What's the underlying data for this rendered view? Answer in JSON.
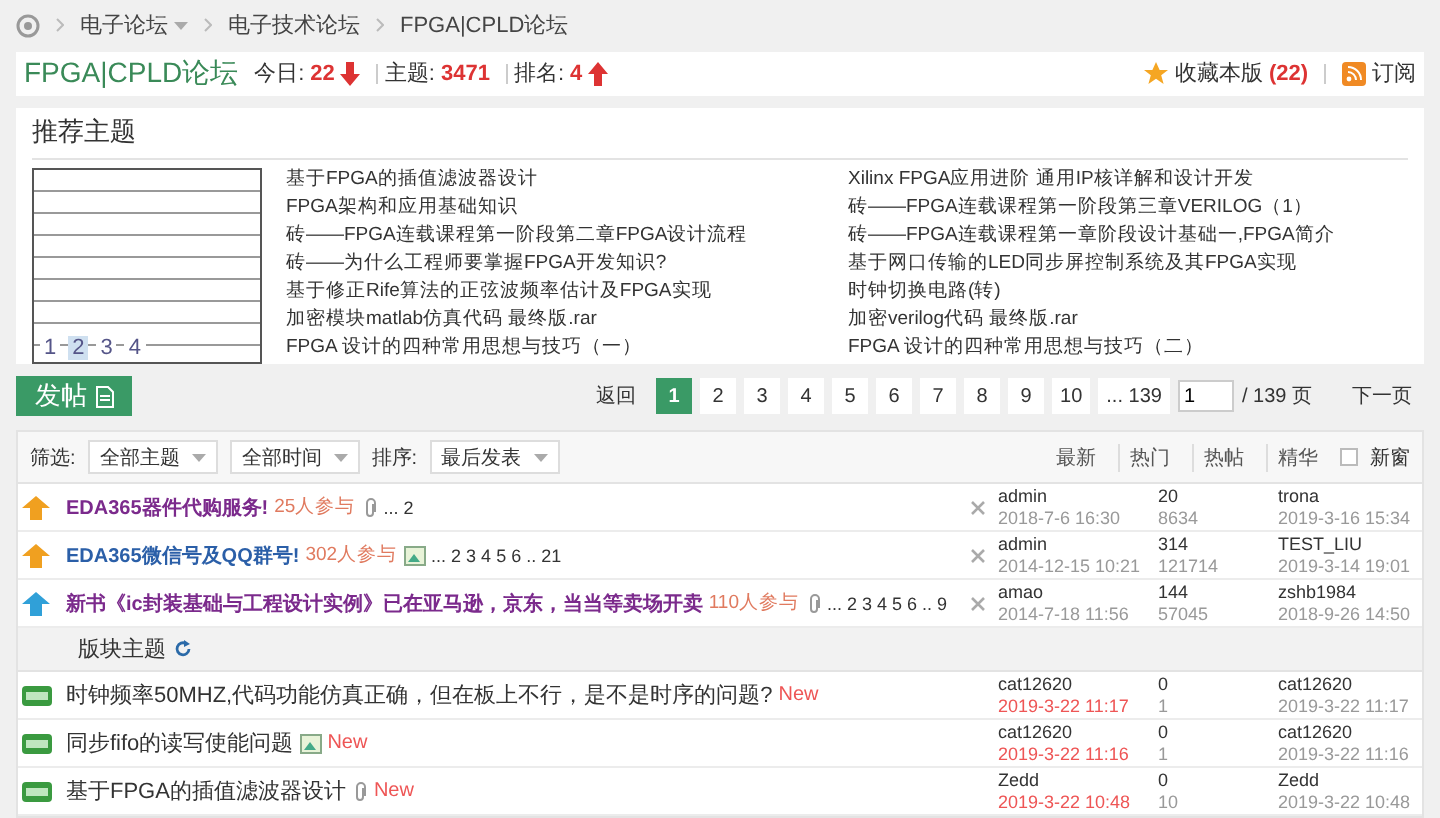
{
  "breadcrumb": [
    {
      "label": "电子论坛",
      "has_menu": true
    },
    {
      "label": "电子技术论坛",
      "has_menu": false
    },
    {
      "label": "FPGA|CPLD论坛",
      "has_menu": false
    }
  ],
  "forum_header": {
    "title": "FPGA|CPLD论坛",
    "stats": [
      {
        "label": "今日:",
        "value": "22",
        "arrow": {
          "kind": "down"
        }
      },
      {
        "label": "主题:",
        "value": "3471"
      },
      {
        "label": "排名:",
        "value": "4",
        "arrow": {
          "kind": "up"
        }
      }
    ],
    "favorite": {
      "label": "收藏本版",
      "count": "(22)"
    },
    "subscribe": "订阅"
  },
  "recommended": {
    "title": "推荐主题",
    "slides": [
      {
        "label": "1",
        "selected": false
      },
      {
        "label": "2",
        "selected": true
      },
      {
        "label": "3",
        "selected": false
      },
      {
        "label": "4",
        "selected": false
      }
    ],
    "topics": [
      "基于FPGA的插值滤波器设计",
      "Xilinx FPGA应用进阶 通用IP核详解和设计开发",
      " FPGA架构和应用基础知识",
      "砖——FPGA连载课程第一阶段第三章VERILOG（1）",
      "砖——FPGA连载课程第一阶段第二章FPGA设计流程",
      "砖——FPGA连载课程第一章阶段设计基础一,FPGA简介",
      "砖——为什么工程师要掌握FPGA开发知识?",
      "基于网口传输的LED同步屏控制系统及其FPGA实现",
      "基于修正Rife算法的正弦波频率估计及FPGA实现",
      "时钟切换电路(转)",
      "加密模块matlab仿真代码 最终版.rar",
      "加密verilog代码 最终版.rar",
      "FPGA 设计的四种常用思想与技巧（一）",
      "FPGA 设计的四种常用思想与技巧（二）"
    ]
  },
  "post_button": "发帖",
  "pagination": {
    "back": "返回",
    "pages": [
      {
        "label": "1",
        "selected": true
      },
      {
        "label": "2",
        "selected": false
      },
      {
        "label": "3",
        "selected": false
      },
      {
        "label": "4",
        "selected": false
      },
      {
        "label": "5",
        "selected": false
      },
      {
        "label": "6",
        "selected": false
      },
      {
        "label": "7",
        "selected": false
      },
      {
        "label": "8",
        "selected": false
      },
      {
        "label": "9",
        "selected": false
      },
      {
        "label": "10",
        "selected": false
      },
      {
        "label": "... 139",
        "selected": false
      }
    ],
    "page_input": "1",
    "total": "/ 139 页",
    "next": "下一页"
  },
  "filters": {
    "label": "筛选:",
    "selects": [
      "全部主题",
      "全部时间"
    ],
    "sort_label": "排序:",
    "sort": "最后发表",
    "tabs": [
      "最新",
      "热门",
      "热帖",
      "精华"
    ],
    "new_window": {
      "label": "新窗",
      "checked": false
    }
  },
  "sticky_threads": [
    {
      "kind": "global",
      "title": "EDA365器件代购服务!",
      "color": "#7b2a8c",
      "participants": "25人参与",
      "attachment": {
        "kind": "clip"
      },
      "pages": "... 2",
      "author": "admin",
      "date": "2018-7-6 16:30",
      "replies": "20",
      "views": "8634",
      "last_poster": "trona",
      "last_date": "2019-3-16 15:34"
    },
    {
      "kind": "global",
      "title": "EDA365微信号及QQ群号!",
      "color": "#2b5fa8",
      "participants": "302人参与",
      "attachment": {
        "kind": "image"
      },
      "pages": "... 2 3 4 5 6 .. 21",
      "author": "admin",
      "date": "2014-12-15 10:21",
      "replies": "314",
      "views": "121714",
      "last_poster": "TEST_LIU",
      "last_date": "2019-3-14 19:01"
    },
    {
      "kind": "forum",
      "title": "新书《ic封装基础与工程设计实例》已在亚马逊，京东，当当等卖场开卖",
      "color": "#7b2a8c",
      "participants": "110人参与",
      "attachment": {
        "kind": "clip"
      },
      "pages": "... 2 3 4 5 6 .. 9",
      "author": "amao",
      "date": "2014-7-18 11:56",
      "replies": "144",
      "views": "57045",
      "last_poster": "zshb1984",
      "last_date": "2018-9-26 14:50"
    }
  ],
  "section_title": "版块主题",
  "threads": [
    {
      "title": "时钟频率50MHZ,代码功能仿真正确，但在板上不行，是不是时序的问题?",
      "badge": "New",
      "author": "cat12620",
      "date": "2019-3-22 11:17",
      "replies": "0",
      "views": "1",
      "last_poster": "cat12620",
      "last_date": "2019-3-22 11:17"
    },
    {
      "title": " 同步fifo的读写使能问题",
      "attachment": {
        "kind": "image"
      },
      "badge": "New",
      "author": "cat12620",
      "date": "2019-3-22 11:16",
      "replies": "0",
      "views": "1",
      "last_poster": "cat12620",
      "last_date": "2019-3-22 11:16"
    },
    {
      "title": "基于FPGA的插值滤波器设计",
      "attachment": {
        "kind": "clip"
      },
      "badge": "New",
      "author": "Zedd",
      "date": "2019-3-22 10:48",
      "replies": "0",
      "views": "10",
      "last_poster": "Zedd",
      "last_date": "2019-3-22 10:48"
    }
  ]
}
